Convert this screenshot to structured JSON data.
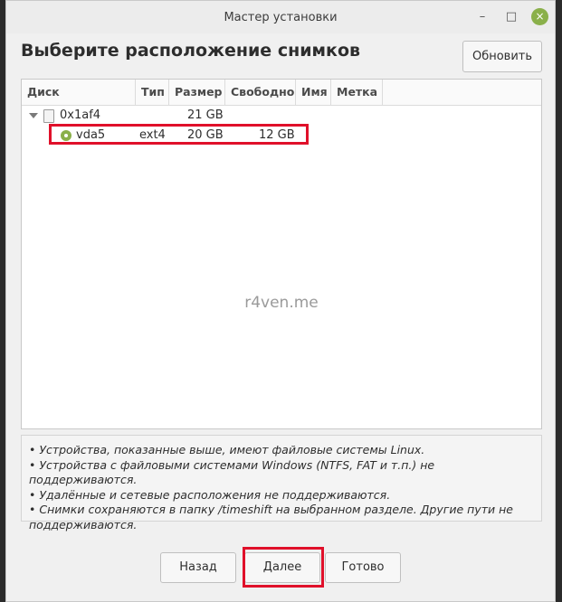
{
  "window": {
    "title": "Мастер установки",
    "controls": {
      "minimize": "–",
      "maximize": "□",
      "close": "×"
    }
  },
  "heading": "Выберите расположение снимков",
  "refresh_label": "Обновить",
  "table": {
    "columns": [
      "Диск",
      "Тип",
      "Размер",
      "Свободно",
      "Имя",
      "Метка"
    ],
    "rows": [
      {
        "name": "0x1af4",
        "type": "",
        "size": "21 GB",
        "free": "",
        "label_name": "",
        "label": "",
        "icon": "disk-icon",
        "expanded": true
      },
      {
        "name": "vda5",
        "type": "ext4",
        "size": "20 GB",
        "free": "12 GB",
        "label_name": "",
        "label": "",
        "icon": "partition-icon",
        "selected": true
      }
    ]
  },
  "watermark": "r4ven.me",
  "notes": [
    "• Устройства, показанные выше, имеют файловые системы Linux.",
    "• Устройства с файловыми системами Windows (NTFS, FAT и т.п.) не поддерживаются.",
    "• Удалённые и сетевые расположения не поддерживаются.",
    "• Снимки сохраняются в папку /timeshift на выбранном разделе. Другие пути не поддерживаются."
  ],
  "buttons": {
    "back": "Назад",
    "next": "Далее",
    "done": "Готово"
  },
  "colors": {
    "accent": "#8ab04a",
    "highlight": "#e0102a"
  }
}
